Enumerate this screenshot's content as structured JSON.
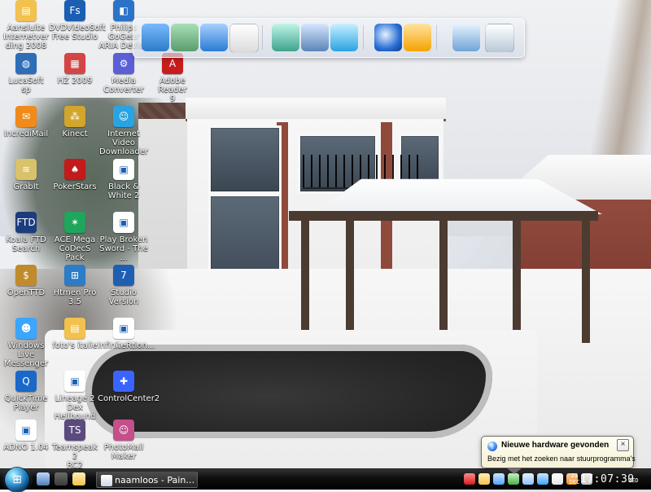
{
  "desktop": {
    "icons": [
      {
        "label": "Aansluite\nInternetver\nding 2008",
        "icon": "folder-icon",
        "color": "#f2c14e"
      },
      {
        "label": "DVDVideoSoft\nFree Studio",
        "icon": "fs-icon",
        "color": "#1b5fb4"
      },
      {
        "label": "Philips GoGear\nARIA Device",
        "icon": "cube-icon",
        "color": "#2b73c9"
      },
      {
        "label": "LucaSoft\nsp",
        "icon": "globe-icon",
        "color": "#2d6eb7"
      },
      {
        "label": "HZ 2009",
        "icon": "calendar-icon",
        "color": "#d44545"
      },
      {
        "label": "Media\nConverter",
        "icon": "gear-icon",
        "color": "#5a5fd6"
      },
      {
        "label": "Adobe Reader\n9",
        "icon": "pdf-icon",
        "color": "#c81d1d"
      },
      {
        "label": "IncrediMail",
        "icon": "mail-icon",
        "color": "#f08a1a"
      },
      {
        "label": "Kinect",
        "icon": "molecule-icon",
        "color": "#d2a62c"
      },
      {
        "label": "Internet Video\nDownloader",
        "icon": "people-icon",
        "color": "#2aa3e2"
      },
      {
        "label": "GrabIt",
        "icon": "bone-icon",
        "color": "#d8c26a"
      },
      {
        "label": "PokerStars",
        "icon": "spade-icon",
        "color": "#c31a1a"
      },
      {
        "label": "Black & White 2",
        "icon": "window-icon",
        "color": "#ffffff"
      },
      {
        "label": "Koala FTD\nSearch",
        "icon": "ftd-icon",
        "color": "#1d3c7d"
      },
      {
        "label": "ACE Mega\nCoDecS Pack",
        "icon": "dots-icon",
        "color": "#1fa55c"
      },
      {
        "label": "Play Broken\nSword - The ...",
        "icon": "window-icon",
        "color": "#ffffff"
      },
      {
        "label": "OpenTTD",
        "icon": "dollar-icon",
        "color": "#c08b2b"
      },
      {
        "label": "Htmen Pro 3.5",
        "icon": "windows-flag-icon",
        "color": "#2c7cc7"
      },
      {
        "label": "Studio Version",
        "icon": "seven-icon",
        "color": "#1e5fb2"
      },
      {
        "label": "Windows Live\nMessenger",
        "icon": "messenger-icon",
        "color": "#3ba6ff"
      },
      {
        "label": "foto's italie",
        "icon": "folder-icon",
        "color": "#f2c14e"
      },
      {
        "label": "InfiniteRtion...",
        "icon": "window-icon",
        "color": "#ffffff"
      },
      {
        "label": "QuickTime\nPlayer",
        "icon": "quicktime-icon",
        "color": "#1a68c9"
      },
      {
        "label": "Lineage 2 Dex\nHellbound",
        "icon": "window-icon",
        "color": "#ffffff"
      },
      {
        "label": "ControlCenter2",
        "icon": "controlcenter-icon",
        "color": "#3a64ff"
      },
      {
        "label": "ADNO 1.04",
        "icon": "window-icon",
        "color": "#ffffff"
      },
      {
        "label": "Teamspeak 2\nRC2",
        "icon": "ts-icon",
        "color": "#5a4a7e"
      },
      {
        "label": "PhotoMail\nMaker",
        "icon": "photo-icon",
        "color": "#c44f8a"
      }
    ]
  },
  "quickbar": {
    "items": [
      {
        "name": "computer-icon",
        "color": "#2c7cc7"
      },
      {
        "name": "tools-icon",
        "color": "#5a9c6c"
      },
      {
        "name": "burn-icon",
        "color": "#2a7bd3"
      },
      {
        "name": "settings-window-icon",
        "color": "#dcdcdc"
      },
      {
        "name": "network-icon",
        "color": "#3ea38c"
      },
      {
        "name": "document-icon",
        "color": "#5a84b6"
      },
      {
        "name": "media-player-icon",
        "color": "#2aa3e2"
      },
      {
        "name": "internet-explorer-icon",
        "color": "#2a6fd6"
      },
      {
        "name": "media-center-icon",
        "color": "#f5a300"
      },
      {
        "name": "devices-icon",
        "color": "#6fa4d6"
      },
      {
        "name": "recycle-bin-icon",
        "color": "#b7c8d9"
      }
    ]
  },
  "taskbar": {
    "task_label": "naamloos - PaintReag...",
    "tray": {
      "date": "23\nDEC",
      "time": "17:07:39",
      "dow": "WED"
    },
    "quick_launch": [
      {
        "name": "show-desktop-icon",
        "color": "#4f7fb7"
      },
      {
        "name": "switch-windows-icon",
        "color": "#3b3b3b"
      },
      {
        "name": "grab-icon",
        "color": "#f2c14e"
      }
    ],
    "tray_icons": [
      {
        "name": "ati-icon",
        "color": "#d11f1f"
      },
      {
        "name": "shield-icon",
        "color": "#f2c14e"
      },
      {
        "name": "network-tray-icon",
        "color": "#4fa3ff"
      },
      {
        "name": "security-icon",
        "color": "#48b04a"
      },
      {
        "name": "cloud-icon",
        "color": "#8fbfff"
      },
      {
        "name": "messenger-tray-icon",
        "color": "#3ba6ff"
      },
      {
        "name": "sound-icon",
        "color": "#e6e6e6"
      },
      {
        "name": "alert-icon",
        "color": "#f08a1a"
      },
      {
        "name": "hardware-icon",
        "color": "#c7c7c7"
      }
    ]
  },
  "notification": {
    "title": "Nieuwe hardware gevonden",
    "message": "Bezig met het zoeken naar stuurprogramma's",
    "close": "×",
    "info": "i"
  }
}
